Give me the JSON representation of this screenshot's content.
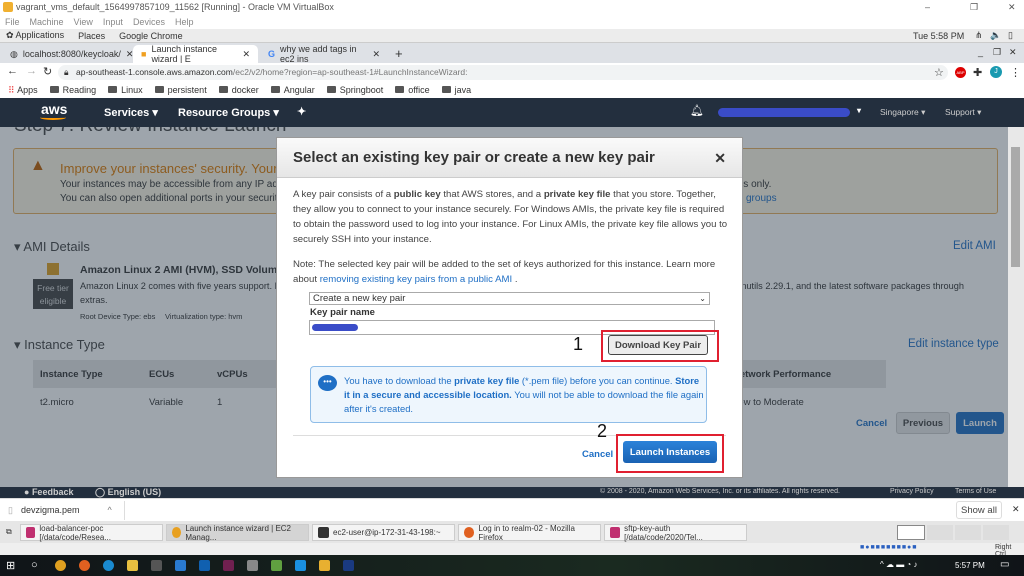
{
  "window": {
    "title": "vagrant_vms_default_1564997857109_11562 [Running] - Oracle VM VirtualBox",
    "menu": [
      "File",
      "Machine",
      "View",
      "Input",
      "Devices",
      "Help"
    ]
  },
  "gnome": {
    "items": [
      "Applications",
      "Places",
      "Google Chrome"
    ],
    "clock": "Tue  5:58 PM"
  },
  "browser": {
    "tabs": [
      {
        "label": "localhost:8080/keycloak/",
        "icon": "globe-icon"
      },
      {
        "label": "Launch instance wizard | E",
        "icon": "aws-icon"
      },
      {
        "label": "why we add tags in ec2 ins",
        "icon": "google-icon"
      }
    ],
    "url_host": "ap-southeast-1.console.aws.amazon.com",
    "url_path": "/ec2/v2/home?region=ap-southeast-1#LaunchInstanceWizard:",
    "profile_initial": "J",
    "abp": "ABP",
    "bookmarks": [
      "Apps",
      "Reading",
      "Linux",
      "persistent",
      "docker",
      "Angular",
      "Springboot",
      "office",
      "java"
    ]
  },
  "aws_nav": {
    "logo": "aws",
    "services": "Services",
    "resource_groups": "Resource Groups",
    "region": "Singapore",
    "support": "Support"
  },
  "page": {
    "step_title": "Step 7: Review Instance Launch",
    "warning_title": "Improve your instances' security. Your security group, launch-wizard, is open to the world.",
    "warning_line1": "Your instances may be accessible from any IP address. We recommend that you update your security group rules to allow access from known IP addresses only.",
    "warning_line2": "You can also open additional ports in your security group to facilitate access to the application or service you're running, e.g., HTTP (80) for web servers.",
    "warning_link": "groups",
    "ami_heading": "AMI Details",
    "edit_ami": "Edit AMI",
    "ami_name": "Amazon Linux 2 AMI (HVM), SSD Volume Type",
    "free_tier": "Free tier eligible",
    "ami_desc": "Amazon Linux 2 comes with five years support. It provides Linux kernel 4.14 tuned for optimal performance on Amazon EC2, systemd 219, GCC 7.3, Glibc 2.26, Binutils 2.29.1, and the latest software packages through",
    "ami_desc2": "extras.",
    "root_device": "Root Device Type: ebs",
    "virt_type": "Virtualization type: hvm",
    "instance_heading": "Instance Type",
    "edit_instance": "Edit instance type",
    "table_headers": [
      "Instance Type",
      "ECUs",
      "vCPUs",
      "Network Performance"
    ],
    "table_row": [
      "t2.micro",
      "Variable",
      "1",
      "Low to Moderate"
    ],
    "cancel": "Cancel",
    "previous": "Previous",
    "launch": "Launch"
  },
  "dialog": {
    "title": "Select an existing key pair or create a new key pair",
    "p1a": "A key pair consists of a ",
    "p1b": "public key",
    "p1c": " that AWS stores, and a ",
    "p1d": "private key file",
    "p1e": " that you store. Together, they allow you to connect to your instance securely. For Windows AMIs, the private key file is required to obtain the password used to log into your instance. For Linux AMIs, the private key file allows you to securely SSH into your instance.",
    "note": "Note: The selected key pair will be added to the set of keys authorized for this instance. Learn more about ",
    "note_link": "removing existing key pairs from a public AMI",
    "note_end": " .",
    "select_value": "Create a new key pair",
    "key_name_label": "Key pair name",
    "download_button": "Download Key Pair",
    "info_a": "You have to download the ",
    "info_b": "private key file",
    "info_c": " (*.pem file) before you can continue. ",
    "info_d": "Store it in a secure and accessible location.",
    "info_e": " You will not be able to download the file again after it's created.",
    "cancel": "Cancel",
    "launch_button": "Launch Instances",
    "annotation1": "1",
    "annotation2": "2"
  },
  "footer": {
    "feedback": "Feedback",
    "language": "English (US)",
    "copyright": "© 2008 - 2020, Amazon Web Services, Inc. or its affiliates. All rights reserved.",
    "privacy": "Privacy Policy",
    "terms": "Terms of Use"
  },
  "downloads": {
    "file": "devzigma.pem",
    "show_all": "Show all"
  },
  "vm_taskbar": [
    "load-balancer-poc [/data/code/Resea...",
    "Launch instance wizard | EC2 Manag...",
    "ec2-user@ip-172-31-43-198:~",
    "Log in to realm-02 - Mozilla Firefox",
    "sftp-key-auth [/data/code/2020/Tel..."
  ],
  "vb_status": {
    "host_key": "Right Ctrl"
  },
  "win_taskbar": {
    "clock": "5:57 PM"
  },
  "colors": {
    "aws_nav": "#232f3e",
    "primary_button": "#1f6fc5",
    "annotation_box": "#e02030",
    "warning": "#e07b00"
  }
}
